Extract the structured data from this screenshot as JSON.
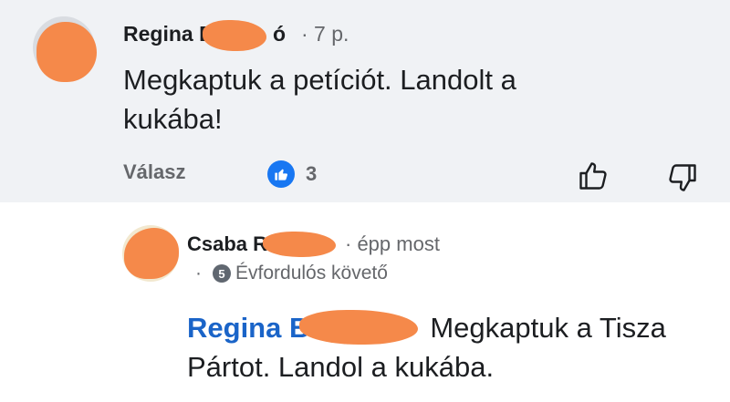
{
  "comment": {
    "author": "Regina B",
    "author_tail": "ó",
    "time": "· 7 p.",
    "text_line1": "Megkaptuk a petíciót. Landolt a",
    "text_line2": "kukába!",
    "reply_label": "Válasz",
    "like_count": "3"
  },
  "reply": {
    "author": "Csaba R",
    "time": "· épp most",
    "dot": "·",
    "badge_level": "5",
    "badge_label": "Évfordulós követő",
    "mention": "Regina B",
    "text_line1": "Megkaptuk a Tisza",
    "text_line2": "Pártot. Landol a kukába."
  },
  "colors": {
    "mention": "#1a64c8",
    "like_badge": "#1877f2",
    "redaction": "#f5894a"
  }
}
